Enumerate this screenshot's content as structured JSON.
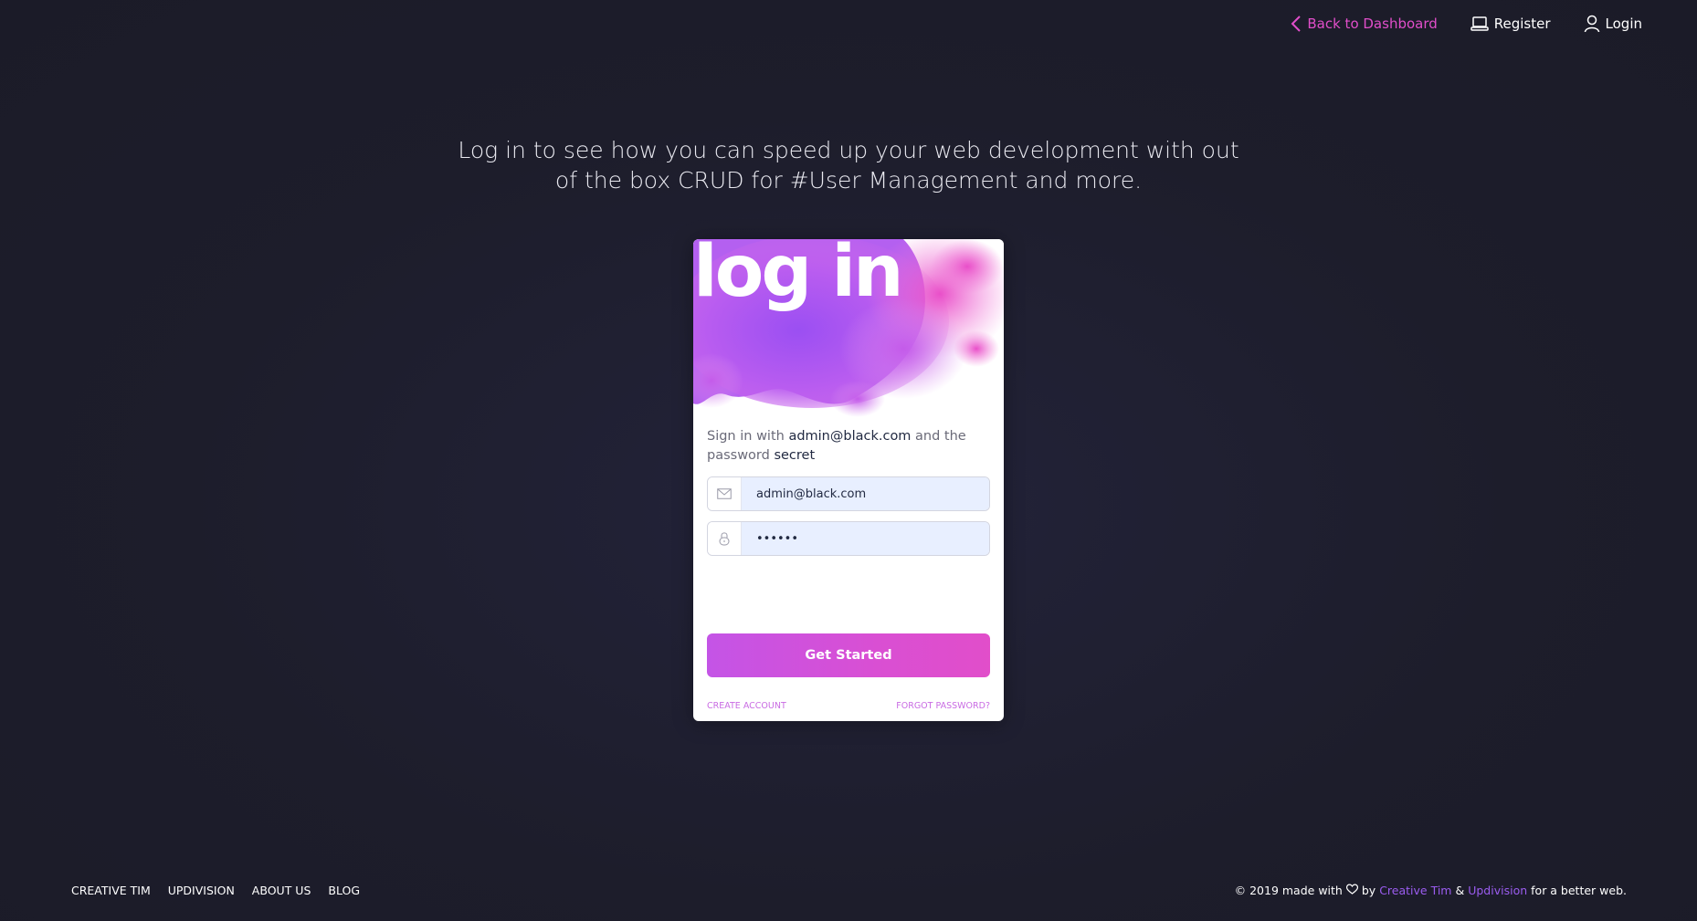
{
  "topnav": {
    "back_label": "Back to Dashboard",
    "register_label": "Register",
    "login_label": "Login"
  },
  "intro": {
    "text": "Log in to see how you can speed up your web development with out of the box CRUD for #User Management and more."
  },
  "card": {
    "title": "log in",
    "hint_prefix": "Sign in with ",
    "hint_email": "admin@black.com",
    "hint_middle": " and the password ",
    "hint_password": "secret",
    "email_value": "admin@black.com",
    "password_value": "secret",
    "submit_label": "Get Started",
    "create_account_label": "CREATE ACCOUNT",
    "forgot_password_label": "FORGOT PASSWORD?"
  },
  "footer": {
    "links": [
      "CREATIVE TIM",
      "UPDIVISION",
      "ABOUT US",
      "BLOG"
    ],
    "copyright_prefix": "© 2019 made with",
    "copyright_by": "by",
    "creative_tim": "Creative Tim",
    "amp": "&",
    "updivision": "Updivision",
    "copyright_suffix": "for a better web."
  },
  "colors": {
    "background": "#1e1e2c",
    "accent_pink": "#e14eca",
    "accent_purple": "#9b5cf0",
    "card": "#ffffff"
  },
  "icons": {
    "back": "chevron-left-icon",
    "register": "laptop-icon",
    "login": "user-icon",
    "email": "envelope-icon",
    "password": "lock-icon",
    "heart": "heart-icon"
  }
}
